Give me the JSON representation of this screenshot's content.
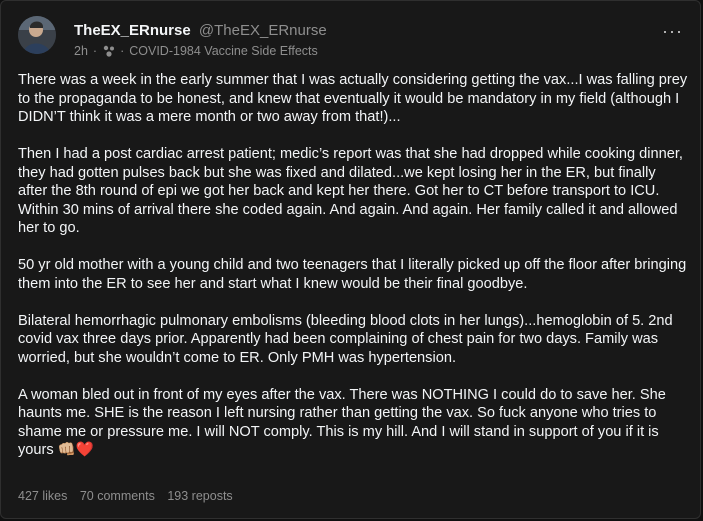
{
  "post": {
    "author": "TheEX_ERnurse",
    "handle": "@TheEX_ERnurse",
    "age": "2h",
    "separator": "·",
    "community": "COVID-1984 Vaccine Side Effects",
    "more_label": "···",
    "paragraphs": [
      "There was a week in the early summer that I was actually considering getting the vax...I was falling prey to the propaganda to be honest, and knew that eventually it would be mandatory in my field (although I DIDN’T think it was a mere month or two away from that!)...",
      "Then I had a post cardiac arrest patient; medic’s report was that she had dropped while cooking dinner, they had gotten pulses back but she was fixed and dilated...we kept losing her in the ER, but finally after the 8th round of epi we got her back and kept her there. Got her to CT before transport to ICU. Within 30 mins of arrival there she coded again. And again. And again. Her family called it and allowed her to go.",
      "50 yr old mother with a young child and two teenagers that I literally picked up off the floor after bringing them into the ER to see her and start what I knew would be their final goodbye.",
      "Bilateral hemorrhagic pulmonary embolisms (bleeding blood clots in her lungs)...hemoglobin of 5. 2nd covid vax three days prior. Apparently had been complaining of chest pain for two days. Family was worried, but she wouldn’t come to ER. Only PMH was hypertension.",
      "A woman bled out in front of my eyes after the vax. There was NOTHING I could do to save her. She haunts me. SHE is the reason I left nursing rather than getting the vax. So fuck anyone who tries to shame me or pressure me. I will NOT comply. This is my hill. And I will stand in support of you if it is yours"
    ],
    "trailing_emoji": "👊🏼❤️",
    "stats": {
      "likes": "427 likes",
      "comments": "70 comments",
      "reposts": "193 reposts"
    }
  },
  "colors": {
    "background": "#181818",
    "primary_text": "#f3f5f7",
    "secondary_text": "#8e8e8e",
    "border": "#2f2f2f"
  },
  "icons": {
    "avatar": "profile-photo",
    "community": "community-icon",
    "more": "more-horizontal-icon"
  }
}
